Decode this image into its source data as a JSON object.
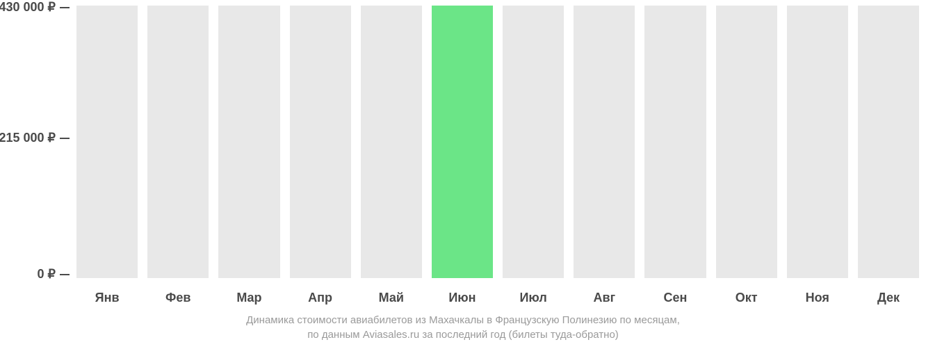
{
  "chart_data": {
    "type": "bar",
    "categories": [
      "Янв",
      "Фев",
      "Мар",
      "Апр",
      "Май",
      "Июн",
      "Июл",
      "Авг",
      "Сен",
      "Окт",
      "Ноя",
      "Дек"
    ],
    "values": [
      null,
      null,
      null,
      null,
      null,
      430000,
      null,
      null,
      null,
      null,
      null,
      null
    ],
    "title": "",
    "xlabel": "",
    "ylabel": "",
    "ylim": [
      0,
      430000
    ],
    "ytick_labels": [
      "430 000 ₽",
      "215 000 ₽",
      "0 ₽"
    ],
    "accent_color": "#6be587",
    "placeholder_color": "#e8e8e8"
  },
  "caption": {
    "line1": "Динамика стоимости авиабилетов из Махачкалы в Французскую Полинезию по месяцам,",
    "line2": "по данным Aviasales.ru за последний год (билеты туда-обратно)"
  }
}
